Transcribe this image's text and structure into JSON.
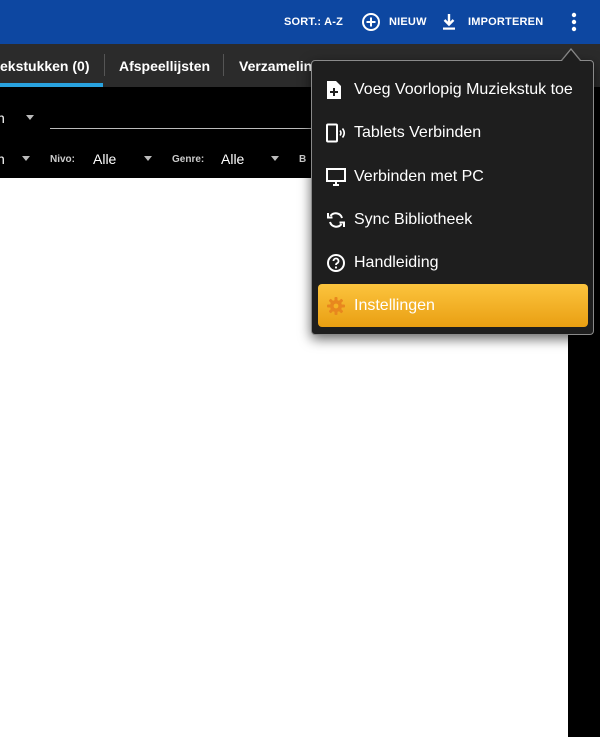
{
  "toolbar": {
    "sort_label": "SORT.: A-Z",
    "new_label": "NIEUW",
    "import_label": "IMPORTEREN"
  },
  "tabs": [
    {
      "label": "ekstukken (0)",
      "active": true
    },
    {
      "label": "Afspeellijsten",
      "active": false
    },
    {
      "label": "Verzamelingen",
      "active": false
    }
  ],
  "filters": {
    "row1_value": "n",
    "row2_value": "n",
    "nivo_label": "Nivo:",
    "nivo_value": "Alle",
    "genre_label": "Genre:",
    "genre_value": "Alle",
    "next_label": "B"
  },
  "menu": {
    "items": [
      {
        "label": "Voeg Voorlopig Muziekstuk toe",
        "icon": "add-file-icon"
      },
      {
        "label": "Tablets Verbinden",
        "icon": "tablet-connect-icon"
      },
      {
        "label": "Verbinden met PC",
        "icon": "monitor-icon"
      },
      {
        "label": "Sync Bibliotheek",
        "icon": "sync-icon"
      },
      {
        "label": "Handleiding",
        "icon": "help-icon"
      },
      {
        "label": "Instellingen",
        "icon": "gear-icon",
        "active": true
      }
    ]
  },
  "colors": {
    "app_bar": "#0d47a1",
    "tab_bar": "#2b2b2b",
    "tab_indicator": "#29a3e0",
    "menu_bg": "#1e1e1e",
    "menu_active": "#f5b325",
    "settings_icon": "#e8871e"
  }
}
